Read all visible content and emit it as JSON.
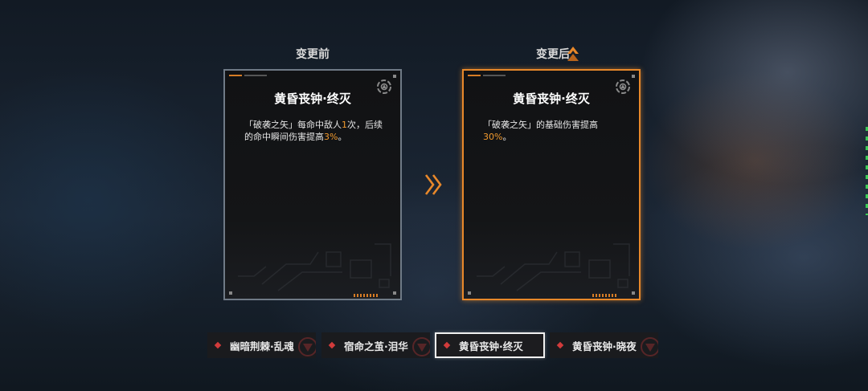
{
  "labels": {
    "before": "变更前",
    "after": "变更后"
  },
  "cards": {
    "before": {
      "title": "黄昏丧钟·终灭",
      "desc_1": "「破袭之矢」每命中敌人",
      "desc_hl1": "1",
      "desc_2": "次，后续的命中瞬间伤害提高",
      "desc_hl2": "3%",
      "desc_3": "。"
    },
    "after": {
      "title": "黄昏丧钟·终灭",
      "desc_1": "「破袭之矢」的基础伤害提高",
      "desc_hl1": "30%",
      "desc_2": "。"
    }
  },
  "tabs": [
    {
      "label": "幽暗荆棘·乱魂"
    },
    {
      "label": "宿命之茧·泪华"
    },
    {
      "label": "黄昏丧钟·终灭"
    },
    {
      "label": "黄昏丧钟·晓夜"
    }
  ],
  "selected_tab": "黄昏丧钟·终灭",
  "colors": {
    "accent": "#e8882a",
    "highlight": "#f29a2e",
    "tab_marker": "#d23b3b",
    "card_border_before": "#6f7a86"
  },
  "icons": {
    "card_emblem": "gear-emblem-icon",
    "transition": "double-chevron-right-icon",
    "tab_marker": "diamond-icon"
  }
}
